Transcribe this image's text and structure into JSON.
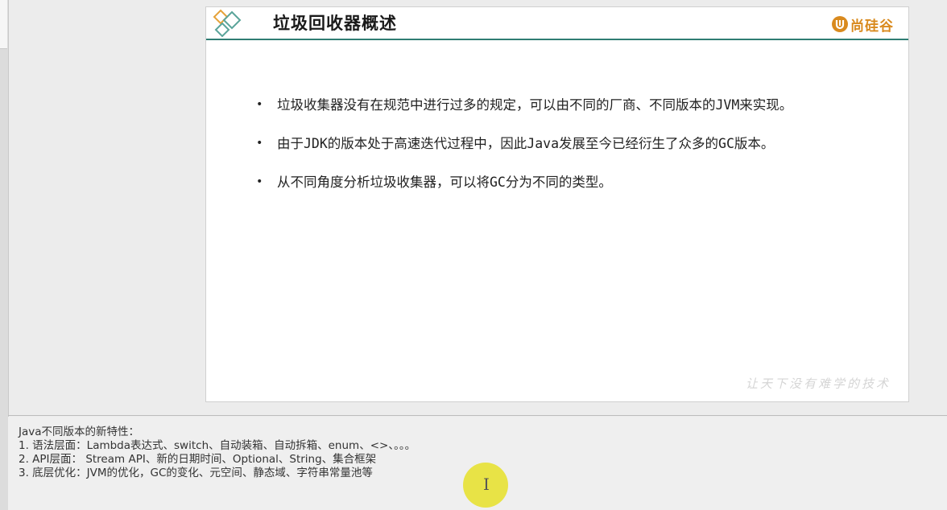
{
  "slide": {
    "title": "垃圾回收器概述",
    "brand": "尚硅谷",
    "bullets": [
      "垃圾收集器没有在规范中进行过多的规定，可以由不同的厂商、不同版本的JVM来实现。",
      "由于JDK的版本处于高速迭代过程中，因此Java发展至今已经衍生了众多的GC版本。",
      "从不同角度分析垃圾收集器，可以将GC分为不同的类型。"
    ],
    "watermark": "让天下没有难学的技术"
  },
  "notes": {
    "lines": [
      "Java不同版本的新特性：",
      "1.  语法层面：Lambda表达式、switch、自动装箱、自动拆箱、enum、<>、。。。",
      "2.  API层面： Stream API、新的日期时间、Optional、String、集合框架",
      "3.  底层优化：JVM的优化，GC的变化、元空间、静态域、字符串常量池等"
    ]
  },
  "colors": {
    "header_rule": "#2f7d73",
    "brand_orange": "#d98a1e",
    "highlight_yellow": "#e6e128"
  },
  "icons": {
    "slide_logo": "diamond-logo-icon",
    "brand_logo": "brand-u-icon",
    "cursor": "text-cursor-icon"
  }
}
